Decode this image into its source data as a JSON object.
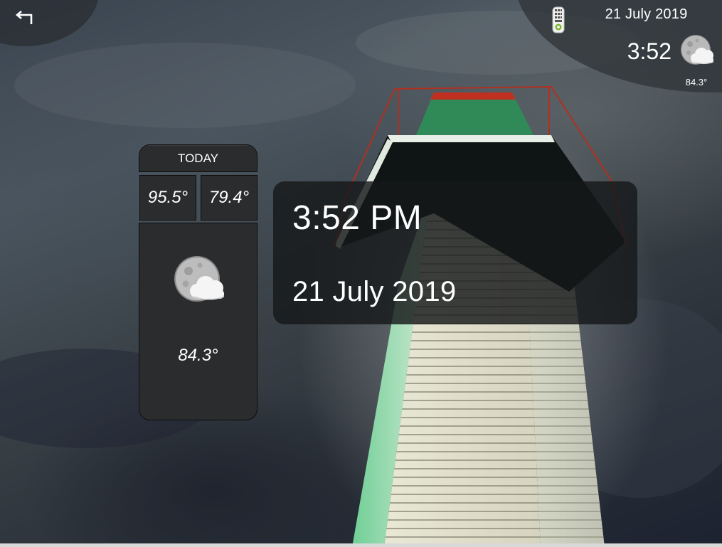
{
  "header": {
    "back_icon": "back-arrow-icon",
    "remote_icon": "remote-control-icon",
    "date": "21 July 2019",
    "time": "3:52",
    "weather_icon": "night-partly-cloudy-icon",
    "current_temp": "84.3°"
  },
  "today": {
    "title": "TODAY",
    "high": "95.5°",
    "low": "79.4°",
    "weather_icon": "night-partly-cloudy-icon",
    "current_temp": "84.3°"
  },
  "clock": {
    "time": "3:52 PM",
    "date": "21 July 2019"
  },
  "colors": {
    "panel": "#2a2c2d",
    "text": "#ffffff",
    "lighthouse_trim": "#c03020",
    "lantern_glass": "#2f8a58"
  }
}
